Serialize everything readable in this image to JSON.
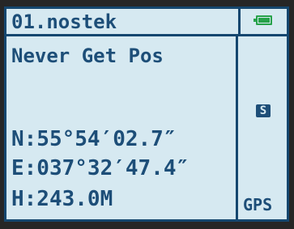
{
  "header": {
    "device_name": "01.nostek",
    "battery_icon": "battery-icon"
  },
  "main": {
    "status": "Never Get Pos",
    "latitude": "N:55°54′02.7″",
    "longitude": "E:037°32′47.4″",
    "height": "H:243.0M"
  },
  "side": {
    "mode_badge": "S",
    "source_label": "GPS"
  },
  "colors": {
    "lcd_background": "#d6e9f1",
    "lcd_text": "#1d4e78",
    "frame_lines": "#15476f",
    "battery": "#27a24a"
  }
}
